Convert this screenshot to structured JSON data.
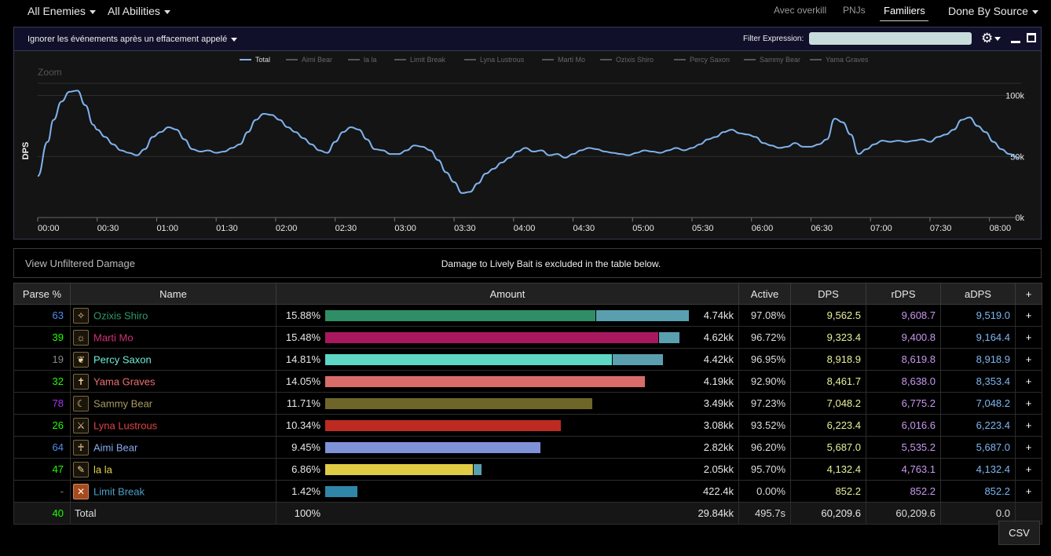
{
  "topbar": {
    "enemies": "All Enemies",
    "abilities": "All Abilities",
    "overkill": "Avec overkill",
    "npcs": "PNJs",
    "pets": "Familiers",
    "source": "Done By Source"
  },
  "graph": {
    "filter_toggle": "Ignorer les événements après un effacement appelé",
    "filter_label": "Filter Expression:",
    "filter_value": "",
    "zoom_label": "Zoom",
    "ylabel": "DPS"
  },
  "chart_data": {
    "type": "line",
    "title": "",
    "ylabel": "DPS",
    "xlabel": "",
    "ylim": [
      0,
      120000
    ],
    "xlim": [
      0,
      496
    ],
    "legend_position": "top-center",
    "legend": [
      "Total",
      "Aimi Bear",
      "la la",
      "Limit Break",
      "Lyna Lustrous",
      "Marti Mo",
      "Ozixis Shiro",
      "Percy Saxon",
      "Sammy Bear",
      "Yama Graves"
    ],
    "x_ticks": [
      "00:00",
      "00:30",
      "01:00",
      "01:30",
      "02:00",
      "02:30",
      "03:00",
      "03:30",
      "04:00",
      "04:30",
      "05:00",
      "05:30",
      "06:00",
      "06:30",
      "07:00",
      "07:30",
      "08:00"
    ],
    "y_ticks": [
      "0k",
      "50k",
      "100k"
    ],
    "y_tick_values": [
      0,
      50000,
      100000
    ],
    "series": [
      {
        "name": "Total",
        "color": "#7fb2ec",
        "x": [
          0,
          5,
          8,
          12,
          16,
          20,
          24,
          28,
          30,
          34,
          38,
          42,
          46,
          50,
          54,
          58,
          62,
          66,
          70,
          74,
          78,
          82,
          86,
          90,
          94,
          98,
          102,
          106,
          110,
          114,
          118,
          122,
          126,
          130,
          134,
          138,
          142,
          146,
          150,
          154,
          158,
          162,
          166,
          170,
          174,
          178,
          182,
          186,
          190,
          194,
          198,
          202,
          206,
          210,
          214,
          218,
          222,
          226,
          230,
          234,
          238,
          242,
          246,
          250,
          254,
          258,
          262,
          266,
          270,
          274,
          278,
          282,
          286,
          290,
          294,
          298,
          302,
          306,
          310,
          314,
          318,
          322,
          326,
          330,
          334,
          338,
          342,
          346,
          350,
          354,
          358,
          362,
          366,
          370,
          374,
          378,
          382,
          386,
          390,
          394,
          398,
          402,
          406,
          410,
          414,
          418,
          422,
          426,
          430,
          434,
          438,
          442,
          446,
          450,
          454,
          458,
          462,
          466,
          470,
          474,
          478,
          482,
          486,
          490,
          495
        ],
        "values": [
          34000,
          62000,
          80000,
          95000,
          103000,
          104000,
          92000,
          76000,
          72000,
          66000,
          60000,
          55000,
          53000,
          51000,
          56000,
          66000,
          70000,
          74000,
          72000,
          64000,
          56000,
          54000,
          55000,
          53000,
          54000,
          57000,
          60000,
          70000,
          80000,
          85000,
          84000,
          80000,
          74000,
          70000,
          65000,
          60000,
          55000,
          53000,
          62000,
          70000,
          74000,
          72000,
          64000,
          56000,
          55000,
          52000,
          52000,
          55000,
          59000,
          58000,
          55000,
          47000,
          37000,
          29000,
          20000,
          21000,
          28000,
          36000,
          40000,
          45000,
          49000,
          54000,
          57000,
          54000,
          55000,
          51000,
          52000,
          49000,
          52000,
          55000,
          57000,
          56000,
          54000,
          53000,
          52000,
          51000,
          53000,
          55000,
          54000,
          53000,
          55000,
          57000,
          55000,
          57000,
          60000,
          64000,
          66000,
          70000,
          72000,
          69000,
          68000,
          66000,
          61000,
          59000,
          57000,
          58000,
          61000,
          58000,
          58000,
          60000,
          64000,
          81000,
          78000,
          68000,
          52000,
          56000,
          60000,
          63000,
          62000,
          63000,
          62000,
          63000,
          64000,
          62000,
          66000,
          68000,
          72000,
          80000,
          82000,
          75000,
          70000,
          62000,
          56000,
          52000,
          49000
        ]
      }
    ]
  },
  "notice": {
    "link": "View Unfiltered Damage",
    "text": "Damage to Lively Bait is excluded in the table below."
  },
  "table": {
    "headers": [
      "Parse %",
      "Name",
      "Amount",
      "Active",
      "DPS",
      "rDPS",
      "aDPS",
      "+"
    ],
    "rows": [
      {
        "parse": "63",
        "parse_color": "#4f8ef0",
        "name": "Ozixis Shiro",
        "name_color": "#2f9a66",
        "icon": "ninja-job-icon",
        "glyph": "✧",
        "pct": "15.88%",
        "bar_frac": 0.744,
        "bar2_frac": 0.256,
        "bar_color": "#2f8e66",
        "bar2_color": "#5a9fb0",
        "amount": "4.74kk",
        "active": "97.08%",
        "dps": "9,562.5",
        "rdps": "9,608.7",
        "adps": "9,519.0"
      },
      {
        "parse": "39",
        "parse_color": "#1eff00",
        "name": "Marti Mo",
        "name_color": "#d23078",
        "icon": "astrologian-job-icon",
        "glyph": "☼",
        "pct": "15.48%",
        "bar_frac": 0.917,
        "bar2_frac": 0.057,
        "bar_color": "#a8185e",
        "bar2_color": "#5a9fb0",
        "amount": "4.62kk",
        "active": "96.72%",
        "dps": "9,323.4",
        "rdps": "9,400.8",
        "adps": "9,164.4"
      },
      {
        "parse": "19",
        "parse_color": "#888888",
        "name": "Percy Saxon",
        "name_color": "#6ef0d8",
        "icon": "dancer-job-icon",
        "glyph": "❦",
        "pct": "14.81%",
        "bar_frac": 0.791,
        "bar2_frac": 0.139,
        "bar_color": "#5ed6c6",
        "bar2_color": "#5a9fb0",
        "amount": "4.42kk",
        "active": "96.95%",
        "dps": "8,918.9",
        "rdps": "8,619.8",
        "adps": "8,918.9"
      },
      {
        "parse": "32",
        "parse_color": "#1eff00",
        "name": "Yama Graves",
        "name_color": "#f07070",
        "icon": "red-mage-job-icon",
        "glyph": "✝",
        "pct": "14.05%",
        "bar_frac": 0.881,
        "bar2_frac": 0,
        "bar_color": "#d96c6a",
        "bar2_color": "#5a9fb0",
        "amount": "4.19kk",
        "active": "92.90%",
        "dps": "8,461.7",
        "rdps": "8,638.0",
        "adps": "8,353.4"
      },
      {
        "parse": "78",
        "parse_color": "#a335ee",
        "name": "Sammy Bear",
        "name_color": "#a89a60",
        "icon": "reaper-job-icon",
        "glyph": "☾",
        "pct": "11.71%",
        "bar_frac": 0.735,
        "bar2_frac": 0,
        "bar_color": "#6e6628",
        "bar2_color": "#5a9fb0",
        "amount": "3.49kk",
        "active": "97.23%",
        "dps": "7,048.2",
        "rdps": "6,775.2",
        "adps": "7,048.2"
      },
      {
        "parse": "26",
        "parse_color": "#1eff00",
        "name": "Lyna Lustrous",
        "name_color": "#e04444",
        "icon": "warrior-job-icon",
        "glyph": "⚔",
        "pct": "10.34%",
        "bar_frac": 0.649,
        "bar2_frac": 0,
        "bar_color": "#bd2a22",
        "bar2_color": "#5a9fb0",
        "amount": "3.08kk",
        "active": "93.52%",
        "dps": "6,223.4",
        "rdps": "6,016.6",
        "adps": "6,223.4"
      },
      {
        "parse": "64",
        "parse_color": "#4f8ef0",
        "name": "Aimi Bear",
        "name_color": "#8aa8f0",
        "icon": "paladin-job-icon",
        "glyph": "♰",
        "pct": "9.45%",
        "bar_frac": 0.593,
        "bar2_frac": 0,
        "bar_color": "#7f92d8",
        "bar2_color": "#5a9fb0",
        "amount": "2.82kk",
        "active": "96.20%",
        "dps": "5,687.0",
        "rdps": "5,535.2",
        "adps": "5,687.0"
      },
      {
        "parse": "47",
        "parse_color": "#1eff00",
        "name": "la la",
        "name_color": "#e8d44a",
        "icon": "scholar-job-icon",
        "glyph": "✎",
        "pct": "6.86%",
        "bar_frac": 0.406,
        "bar2_frac": 0.022,
        "bar_color": "#e0cc44",
        "bar2_color": "#5a9fb0",
        "amount": "2.05kk",
        "active": "95.70%",
        "dps": "4,132.4",
        "rdps": "4,763.1",
        "adps": "4,132.4"
      },
      {
        "parse": "-",
        "parse_color": "#888888",
        "name": "Limit Break",
        "name_color": "#4aa0c8",
        "icon": "limit-break-icon",
        "glyph": "✕",
        "pct": "1.42%",
        "bar_frac": 0.089,
        "bar2_frac": 0,
        "bar_color": "#2f86a8",
        "bar2_color": "#5a9fb0",
        "amount": "422.4k",
        "active": "0.00%",
        "dps": "852.2",
        "rdps": "852.2",
        "adps": "852.2"
      }
    ],
    "total": {
      "parse": "40",
      "name": "Total",
      "pct": "100%",
      "amount": "29.84kk",
      "active": "495.7s",
      "dps": "60,209.6",
      "rdps": "60,209.6",
      "adps": "0.0"
    }
  },
  "csv_label": "CSV",
  "colors": {
    "dps": "#e8f09a",
    "rdps": "#c898f0",
    "adps": "#7eb6f0",
    "green_parse": "#1eff00"
  }
}
